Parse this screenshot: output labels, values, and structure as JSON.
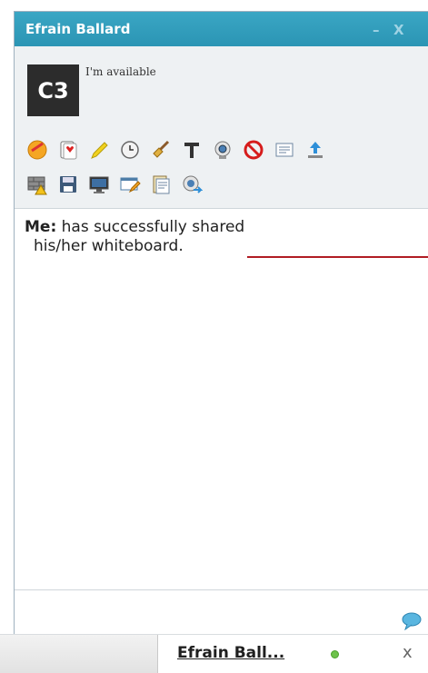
{
  "window": {
    "title": "Efrain Ballard",
    "minimize_label": "–",
    "close_label": "X"
  },
  "profile": {
    "avatar_text": "C3",
    "status": "I'm available"
  },
  "toolbar": {
    "row1": [
      "emoticon-icon",
      "card-game-icon",
      "pencil-icon",
      "clock-icon",
      "broom-icon",
      "text-format-icon",
      "webcam-icon",
      "ban-icon",
      "notes-icon",
      "upload-icon"
    ],
    "row2": [
      "firewall-warning-icon",
      "save-icon",
      "monitor-icon",
      "edit-window-icon",
      "clipboard-icon",
      "webcam-share-icon"
    ]
  },
  "messages": [
    {
      "sender": "Me:",
      "text_line1": " has successfully shared",
      "text_line2": "his/her whiteboard."
    }
  ],
  "bottom_bar": {
    "tab_label": "Efrain Ball...",
    "close_label": "x"
  },
  "colors": {
    "titlebar": "#2b95b4",
    "accent_line": "#b11c24",
    "online": "#6dc24b"
  }
}
